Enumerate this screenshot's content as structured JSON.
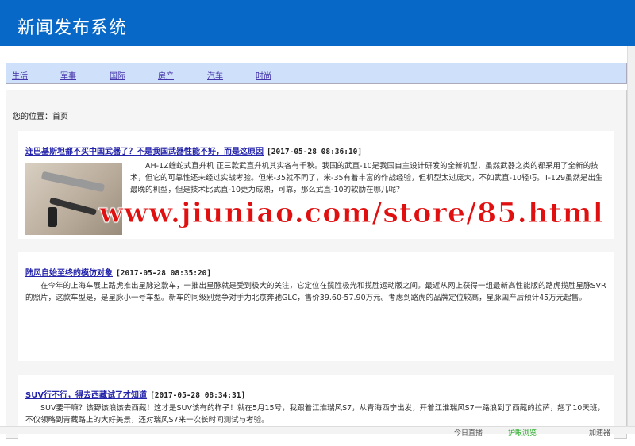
{
  "header": {
    "title": "新闻发布系统"
  },
  "nav": [
    "生活",
    "军事",
    "国际",
    "房产",
    "汽车",
    "时尚"
  ],
  "breadcrumb": "您的位置：首页",
  "articles": [
    {
      "title": "连巴基斯坦都不买中国武器了？不是我国武器性能不好，而是这原因",
      "time": "[2017-05-28 08:36:10]",
      "body": "AH-1Z蝰蛇式直升机 正三款武直升机其实各有千秋。我国的武直-10是我国自主设计研发的全新机型，虽然武器之类的都采用了全新的技术，但它的可靠性还未经过实战考验。但米-35就不同了，米-35有着丰富的作战经验，但机型太过庞大，不如武直-10轻巧。T-129虽然是出生最晚的机型，但是技术比武直-10更为成熟，可靠，那么武直-10的软肋在哪儿呢？"
    },
    {
      "title": "陆风自始至终的模仿对象",
      "time": "[2017-05-28 08:35:20]",
      "body": "在今年的上海车展上路虎推出星脉这款车，一推出星脉就是受到极大的关注，它定位在揽胜极光和揽胜运动版之间。最近从网上获得一组最新高性能版的路虎揽胜星脉SVR的照片，这款车型是，是星脉小一号车型。新车的同级别竞争对手为北京奔驰GLC，售价39.60-57.90万元。考虑到路虎的品牌定位较高，星脉国产后预计45万元起售。"
    },
    {
      "title": "SUV行不行，得去西藏试了才知道",
      "time": "[2017-05-28 08:34:31]",
      "body": "SUV要干嘛？该野该浪该去西藏！这才是SUV该有的样子！就在5月15号，我跟着江淮瑞风S7，从青海西宁出发，开着江淮瑞风S7一路浪到了西藏的拉萨，翘了10天班，不仅领略到青藏路上的大好美景，还对瑞风S7来一次长时间测试与考验。"
    }
  ],
  "watermark": "www.jiuniao.com/store/85.html",
  "statusbar": [
    "今日直播",
    "护眼浏览",
    "加速器"
  ]
}
